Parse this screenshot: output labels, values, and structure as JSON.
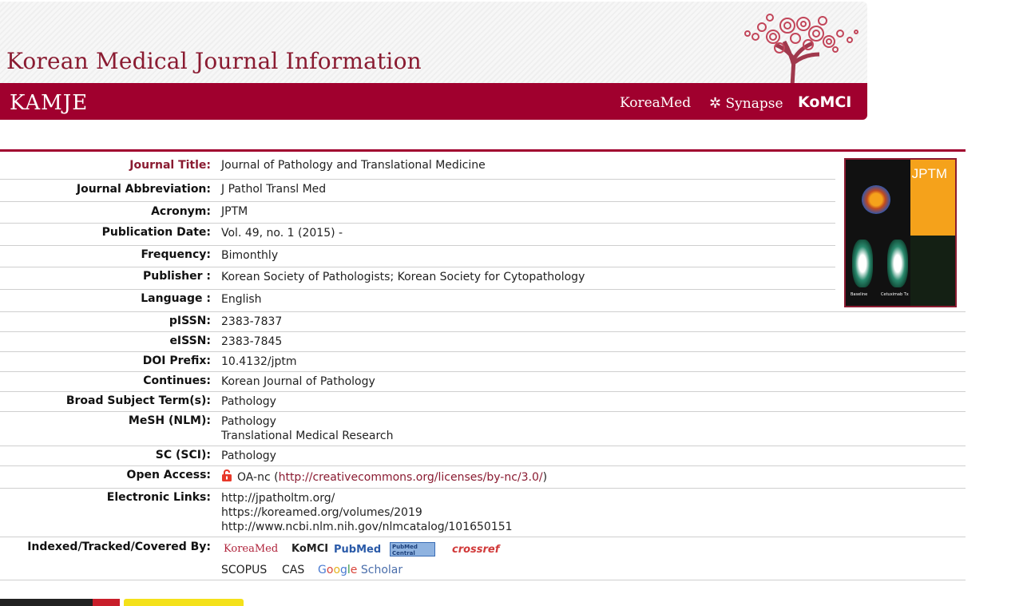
{
  "banner": {
    "title": "Korean Medical Journal Information",
    "brand": "KAMJE",
    "links": [
      "KoreaMed",
      "Synapse",
      "KoMCI"
    ]
  },
  "fields": {
    "journal_title": {
      "label": "Journal Title:",
      "value": "Journal of Pathology and Translational Medicine"
    },
    "abbreviation": {
      "label": "Journal Abbreviation:",
      "value": "J Pathol Transl Med"
    },
    "acronym": {
      "label": "Acronym:",
      "value": "JPTM"
    },
    "publication_date": {
      "label": "Publication Date:",
      "value": "Vol. 49, no. 1 (2015) -"
    },
    "frequency": {
      "label": "Frequency:",
      "value": "Bimonthly"
    },
    "publisher": {
      "label": "Publisher :",
      "value": "Korean Society of Pathologists; Korean Society for Cytopathology"
    },
    "language": {
      "label": "Language :",
      "value": "English"
    },
    "pissn": {
      "label": "pISSN:",
      "value": "2383-7837"
    },
    "eissn": {
      "label": "eISSN:",
      "value": "2383-7845"
    },
    "doi_prefix": {
      "label": "DOI Prefix:",
      "value": "10.4132/jptm"
    },
    "continues": {
      "label": "Continues:",
      "value": "Korean Journal of Pathology"
    },
    "broad_subject": {
      "label": "Broad Subject Term(s):",
      "value": "Pathology"
    },
    "mesh": {
      "label": "MeSH (NLM):",
      "values": [
        "Pathology",
        "Translational Medical Research"
      ]
    },
    "sc": {
      "label": "SC (SCI):",
      "value": "Pathology"
    },
    "open_access": {
      "label": "Open Access:",
      "prefix": "OA-nc (",
      "link": "http://creativecommons.org/licenses/by-nc/3.0/",
      "suffix": ")"
    },
    "electronic_links": {
      "label": "Electronic Links:",
      "values": [
        "http://jpatholtm.org/",
        "https://koreamed.org/volumes/2019",
        "http://www.ncbi.nlm.nih.gov/nlmcatalog/101650151"
      ]
    },
    "indexed": {
      "label": "Indexed/Tracked/Covered By:",
      "logos": [
        "KoreaMed",
        "KoMCI",
        "PubMed",
        "PubMed Central",
        "crossref"
      ],
      "text_items": [
        "SCOPUS",
        "CAS"
      ],
      "google_scholar": [
        "G",
        "o",
        "o",
        "g",
        "l",
        "e",
        " Scholar"
      ]
    }
  },
  "cover": {
    "acronym": "JPTM",
    "caption_left": "Baseline",
    "caption_right": "Cetuximab Tx"
  },
  "colors": {
    "brand": "#a0002e",
    "label_red": "#8a1b31",
    "cover_orange": "#f5a21b"
  }
}
